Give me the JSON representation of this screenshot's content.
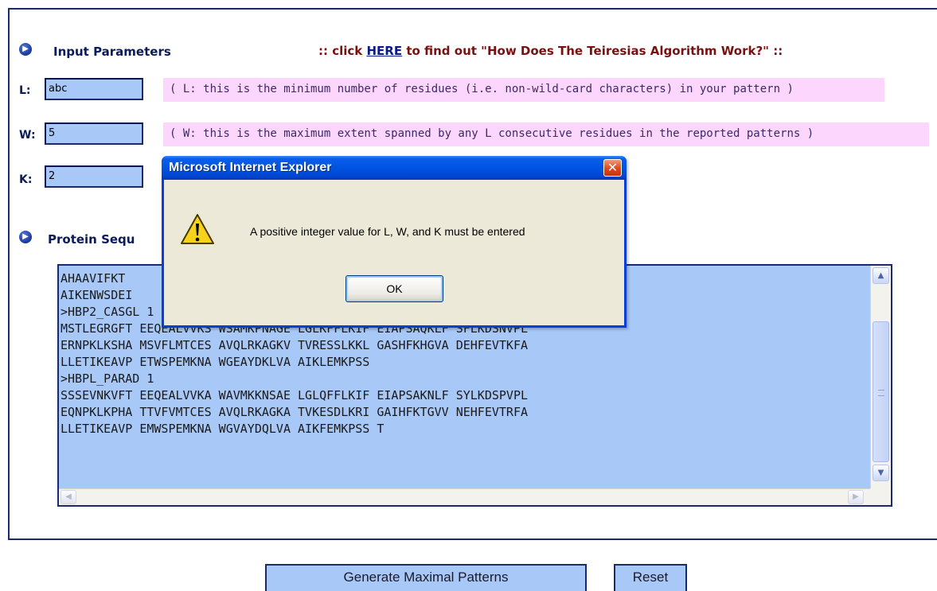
{
  "input_section": {
    "title": "Input Parameters",
    "help_prefix": ":: click ",
    "help_link": "HERE",
    "help_suffix": " to find out \"How Does The Teiresias Algorithm Work?\" ::"
  },
  "params": {
    "L": {
      "label": "L:",
      "value": "abc",
      "hint": "( L: this is the minimum number of residues (i.e. non-wild-card characters) in your pattern )"
    },
    "W": {
      "label": "W:",
      "value": "5",
      "hint": "( W: this is the maximum extent spanned by any L consecutive residues in the reported patterns )"
    },
    "K": {
      "label": "K:",
      "value": "2"
    }
  },
  "sequence_section": {
    "title": "Protein Sequ",
    "lines": [
      "AHAAVIFKT                                               VM KGALLGTIKE",
      "AIKENWSDEI",
      ">HBP2_CASGL 1",
      "MSTLEGRGFT EEQEALVVKS WSAMKPNAGE LGLKFFLKIF EIAPSAQKLF SFLKDSNVPL",
      "ERNPKLKSHA MSVFLMTCES AVQLRKAGKV TVRESSLKKL GASHFKHGVA DEHFEVTKFA",
      "LLETIKEAVP ETWSPEMKNA WGEAYDKLVA AIKLEMKPSS",
      ">HBPL_PARAD 1",
      "SSSEVNKVFT EEQEALVVKA WAVMKKNSAE LGLQFFLKIF EIAPSAKNLF SYLKDSPVPL",
      "EQNPKLKPHA TTVFVMTCES AVQLRKAGKA TVKESDLKRI GAIHFKTGVV NEHFEVTRFA",
      "LLETIKEAVP EMWSPEMKNA WGVAYDQLVA AIKFEMKPSS T"
    ]
  },
  "buttons": {
    "generate": "Generate Maximal Patterns",
    "reset": "Reset"
  },
  "dialog": {
    "title": "Microsoft Internet Explorer",
    "message": "A positive integer value for L, W, and K must be entered",
    "ok": "OK"
  },
  "colors": {
    "input_bg": "#a8c8f8",
    "hint_bg": "#fcd6fc",
    "title_color": "#0a1a5a",
    "help_color": "#7a1010",
    "xp_title_blue": "#0054e3"
  }
}
